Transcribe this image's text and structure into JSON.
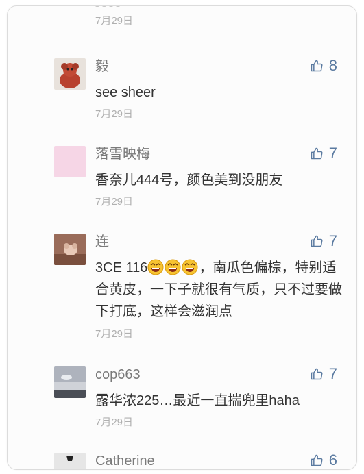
{
  "top": {
    "date": "7月29日"
  },
  "comments": [
    {
      "name": "毅",
      "text": "see sheer",
      "date": "7月29日",
      "likes": "8"
    },
    {
      "name": "落雪映梅",
      "text": "香奈儿444号，颜色美到没朋友",
      "date": "7月29日",
      "likes": "7"
    },
    {
      "name": "连",
      "text_a": "3CE 116",
      "text_b": "，南瓜色偏棕，特别适合黄皮，一下子就很有气质，只不过要做下打底，这样会滋润点",
      "emoji": "laughing-face",
      "emoji_count": 3,
      "date": "7月29日",
      "likes": "7"
    },
    {
      "name": "cop663",
      "text": "露华浓225…最近一直揣兜里haha",
      "date": "7月29日",
      "likes": "7"
    },
    {
      "name": "Catherine",
      "likes": "6"
    }
  ],
  "icons": {
    "like": "thumbs-up-icon"
  },
  "colors": {
    "like": "#5a7aa0",
    "name": "#7a7a7a",
    "date": "#b0b0b0",
    "text": "#333333"
  }
}
